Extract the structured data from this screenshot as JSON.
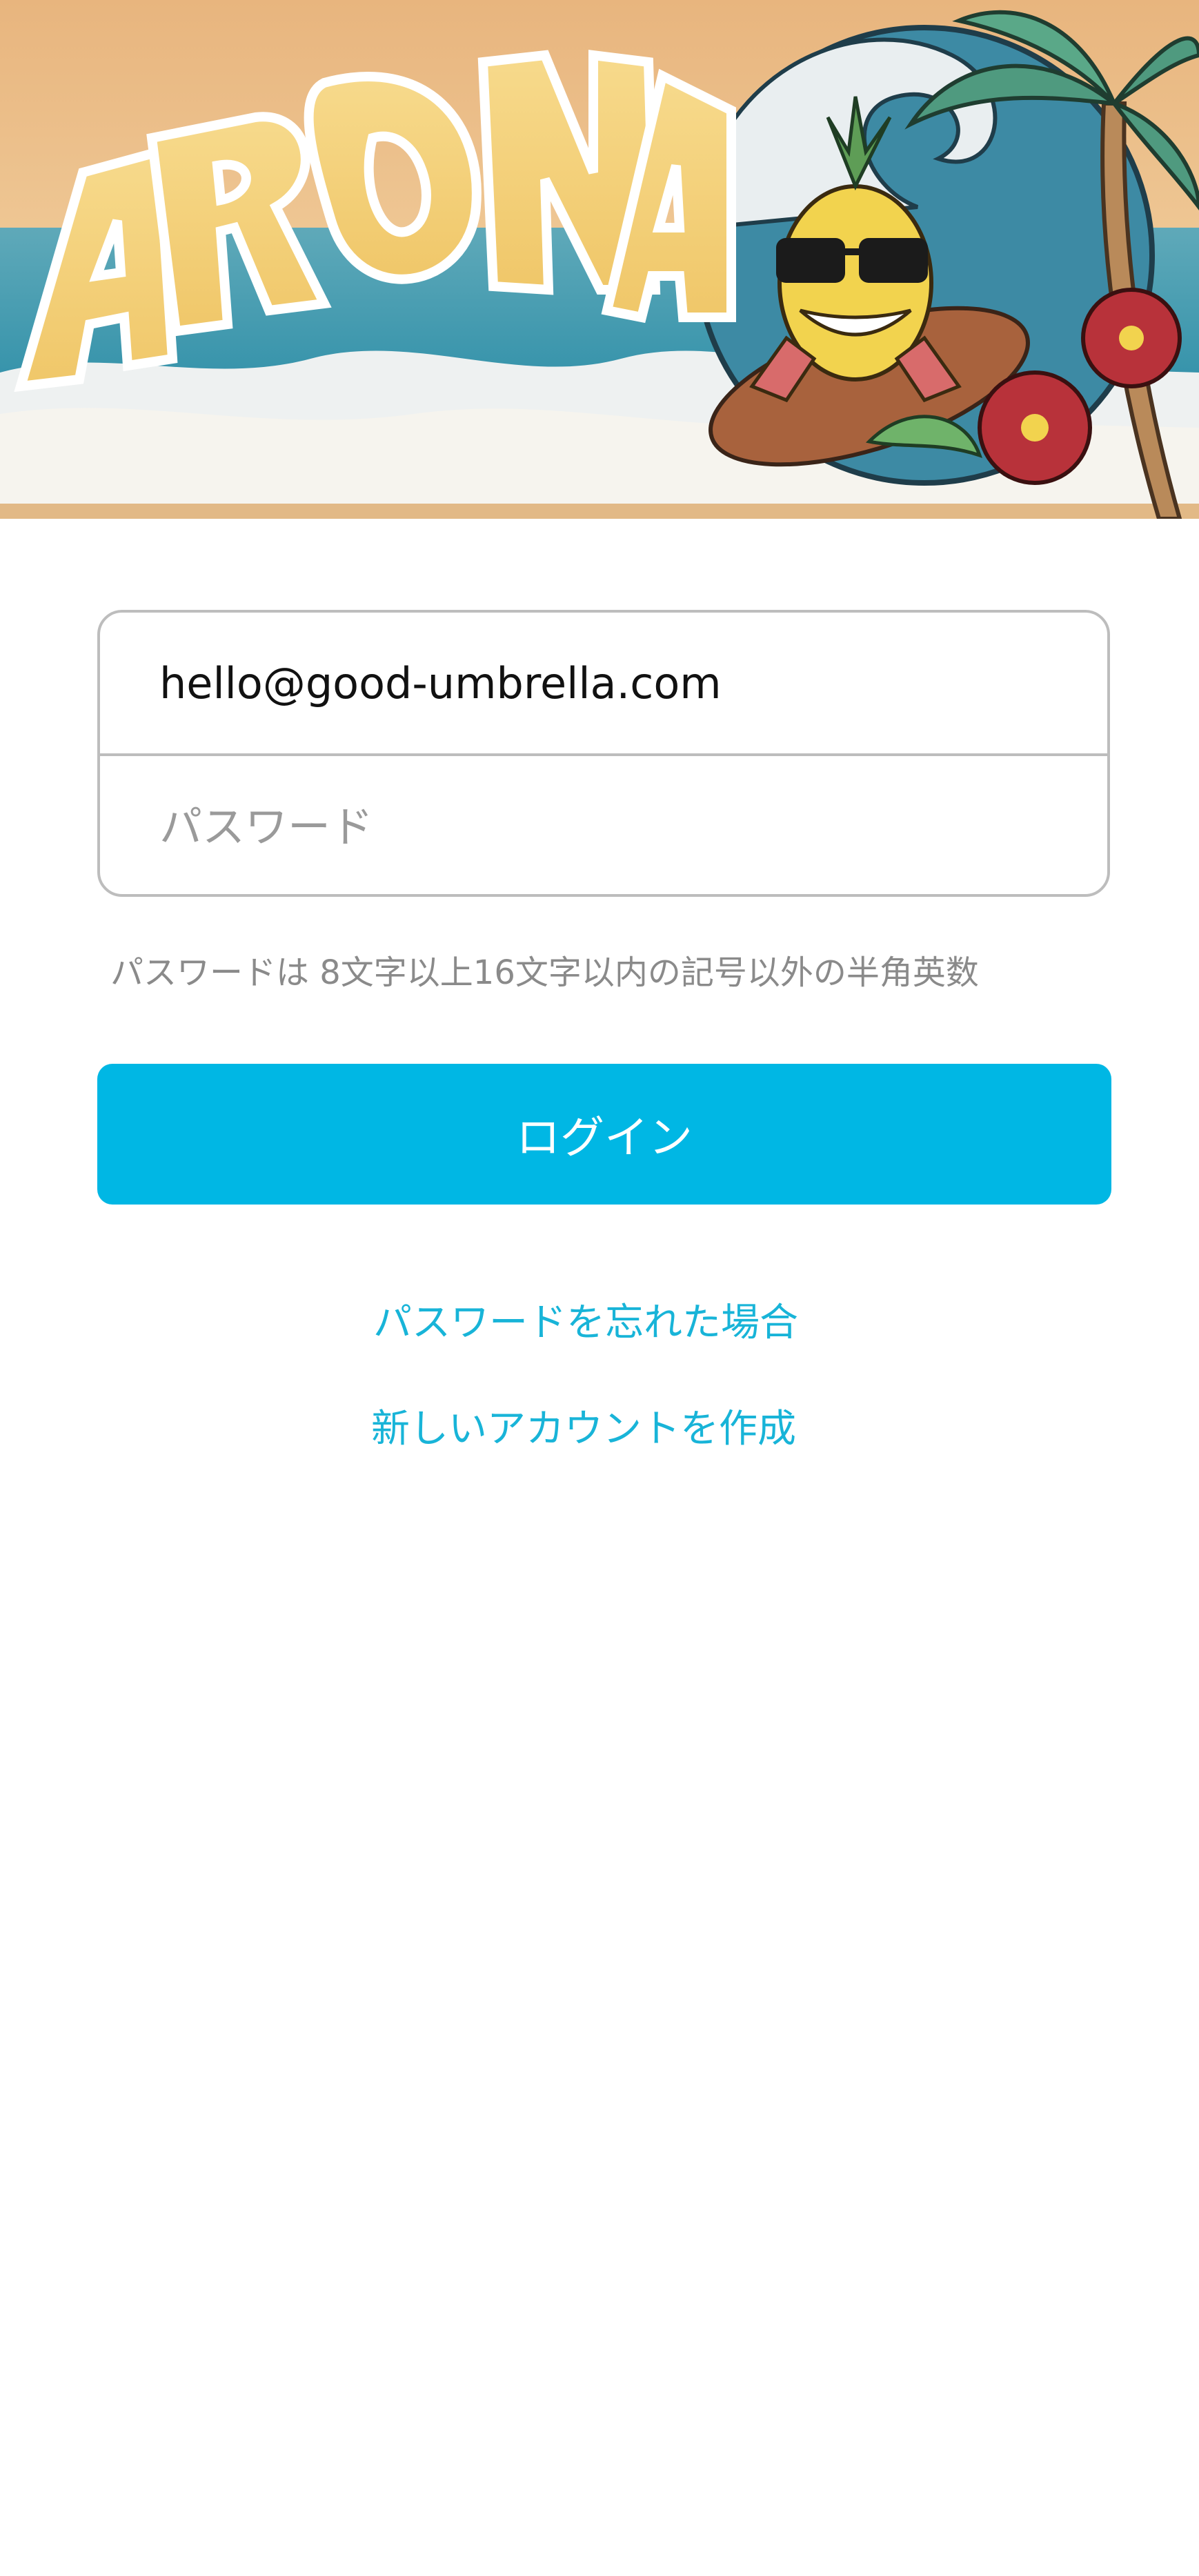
{
  "banner": {
    "logo_text": "ARONA",
    "image_icon": "tropical-surf-pineapple-illustration"
  },
  "form": {
    "email_value": "hello@good-umbrella.com",
    "password_placeholder": "パスワード",
    "password_hint": "パスワードは  8文字以上16文字以内の記号以外の半角英数",
    "login_label": "ログイン"
  },
  "links": {
    "forgot_password": "パスワードを忘れた場合",
    "create_account": "新しいアカウントを作成"
  },
  "colors": {
    "accent": "#00b7e4",
    "link": "#18b4d8",
    "field_border": "#bdbdbd",
    "hint_text": "#8a8a8a"
  }
}
